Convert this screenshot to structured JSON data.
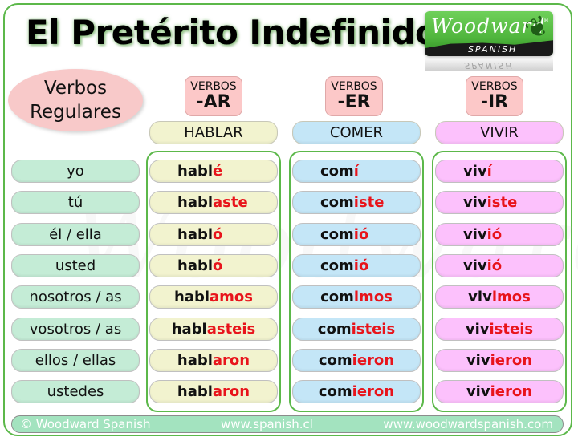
{
  "title": "El Pretérito Indefinido",
  "logo": {
    "brand": "Woodward",
    "registered": "®",
    "subtitle": "SPANISH",
    "icon": "fern-icon"
  },
  "group_label": {
    "line1": "Verbos",
    "line2": "Regulares"
  },
  "pronouns": [
    "yo",
    "tú",
    "él / ella",
    "usted",
    "nosotros / as",
    "vosotros / as",
    "ellos / ellas",
    "ustedes"
  ],
  "columns": [
    {
      "type_small": "VERBOS",
      "type_big": "-AR",
      "infinitive": "HABLAR",
      "color": "#f2f3cf",
      "forms": [
        {
          "stem": "habl",
          "ending": "é"
        },
        {
          "stem": "habl",
          "ending": "aste"
        },
        {
          "stem": "habl",
          "ending": "ó"
        },
        {
          "stem": "habl",
          "ending": "ó"
        },
        {
          "stem": "habl",
          "ending": "amos"
        },
        {
          "stem": "habl",
          "ending": "asteis"
        },
        {
          "stem": "habl",
          "ending": "aron"
        },
        {
          "stem": "habl",
          "ending": "aron"
        }
      ]
    },
    {
      "type_small": "VERBOS",
      "type_big": "-ER",
      "infinitive": "COMER",
      "color": "#c4e6f7",
      "forms": [
        {
          "stem": "com",
          "ending": "í"
        },
        {
          "stem": "com",
          "ending": "iste"
        },
        {
          "stem": "com",
          "ending": "ió"
        },
        {
          "stem": "com",
          "ending": "ió"
        },
        {
          "stem": "com",
          "ending": "imos"
        },
        {
          "stem": "com",
          "ending": "isteis"
        },
        {
          "stem": "com",
          "ending": "ieron"
        },
        {
          "stem": "com",
          "ending": "ieron"
        }
      ]
    },
    {
      "type_small": "VERBOS",
      "type_big": "-IR",
      "infinitive": "VIVIR",
      "color": "#fcc1fc",
      "forms": [
        {
          "stem": "viv",
          "ending": "í"
        },
        {
          "stem": "viv",
          "ending": "iste"
        },
        {
          "stem": "viv",
          "ending": "ió"
        },
        {
          "stem": "viv",
          "ending": "ió"
        },
        {
          "stem": "viv",
          "ending": "imos"
        },
        {
          "stem": "viv",
          "ending": "isteis"
        },
        {
          "stem": "viv",
          "ending": "ieron"
        },
        {
          "stem": "viv",
          "ending": "ieron"
        }
      ]
    }
  ],
  "footer": {
    "copyright": "© Woodward Spanish",
    "site1": "www.spanish.cl",
    "site2": "www.woodwardspanish.com"
  },
  "colors": {
    "frame_green": "#5cb84a",
    "ending_red": "#e8141b",
    "pronoun_bg": "#c4ecd6",
    "verb_type_bg": "#fcc8c8",
    "bubble_bg": "#f8c9c9",
    "footer_bg": "#a3e3bf"
  }
}
